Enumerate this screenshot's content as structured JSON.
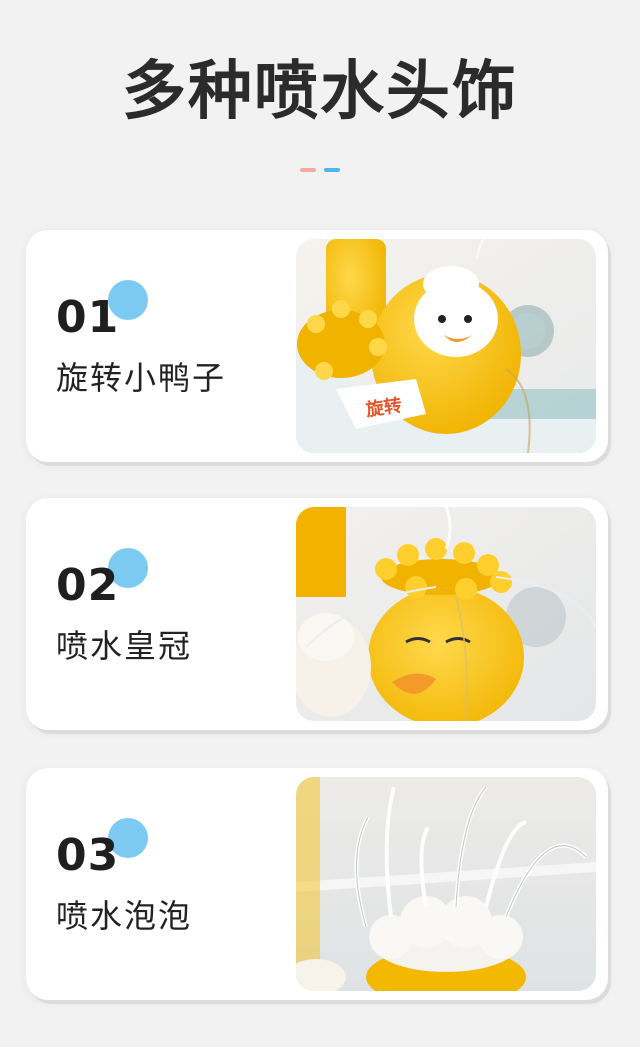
{
  "header": {
    "title": "多种喷水头饰"
  },
  "accent": {
    "pink": "#f4a9a8",
    "blue": "#4fb7ee",
    "dot": "#7ccaf2"
  },
  "cards": [
    {
      "number": "01",
      "label": "旋转小鸭子",
      "photo_icon": "duck-spinner-photo",
      "photo_text": "旋转"
    },
    {
      "number": "02",
      "label": "喷水皇冠",
      "photo_icon": "duck-crown-photo"
    },
    {
      "number": "03",
      "label": "喷水泡泡",
      "photo_icon": "duck-bubble-photo"
    }
  ]
}
